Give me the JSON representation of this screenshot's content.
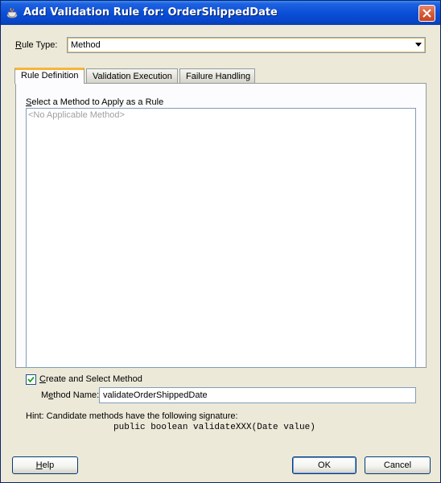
{
  "window": {
    "title": "Add Validation Rule for: OrderShippedDate"
  },
  "rule_type": {
    "label_mnemonic": "R",
    "label_rest": "ule Type:",
    "selected": "Method"
  },
  "tabs": [
    {
      "label": "Rule Definition",
      "active": true
    },
    {
      "label": "Validation Execution",
      "active": false
    },
    {
      "label": "Failure Handling",
      "active": false
    }
  ],
  "method_list": {
    "label_mnemonic": "S",
    "label_rest": "elect a Method to Apply as a Rule",
    "empty_text": "<No Applicable Method>"
  },
  "create_method": {
    "checked": true,
    "label_mnemonic": "C",
    "label_rest": "reate and Select Method"
  },
  "method_name": {
    "label_pre": "M",
    "label_mnemonic": "e",
    "label_rest": "thod Name:",
    "value": "validateOrderShippedDate"
  },
  "hint": {
    "text": "Hint: Candidate methods have the following signature:",
    "signature": "public boolean validateXXX(Date value)"
  },
  "buttons": {
    "help_mnemonic": "H",
    "help_rest": "elp",
    "ok": "OK",
    "cancel": "Cancel"
  },
  "colors": {
    "titlebar": "#0a4fd8",
    "close_button": "#d85c3a",
    "active_tab_accent": "#f8b438",
    "dialog_background": "#ece9d8"
  }
}
